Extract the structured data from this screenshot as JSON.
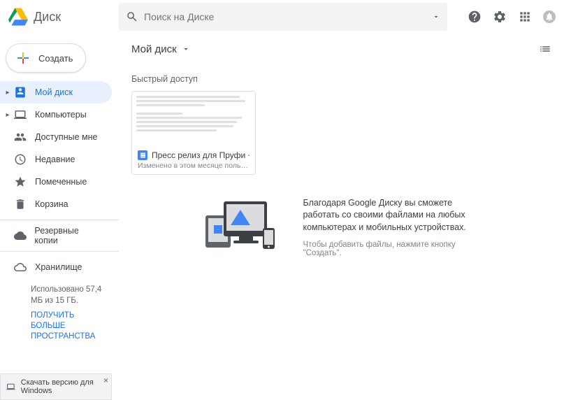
{
  "header": {
    "app_name": "Диск",
    "search_placeholder": "Поиск на Диске"
  },
  "sidebar": {
    "create_label": "Создать",
    "items": [
      {
        "label": "Мой диск",
        "icon": "drive-icon",
        "active": true,
        "expandable": true
      },
      {
        "label": "Компьютеры",
        "icon": "computer-icon",
        "active": false,
        "expandable": true
      },
      {
        "label": "Доступные мне",
        "icon": "shared-icon",
        "active": false,
        "expandable": false
      },
      {
        "label": "Недавние",
        "icon": "clock-icon",
        "active": false,
        "expandable": false
      },
      {
        "label": "Помеченные",
        "icon": "star-icon",
        "active": false,
        "expandable": false
      },
      {
        "label": "Корзина",
        "icon": "trash-icon",
        "active": false,
        "expandable": false
      }
    ],
    "backups_label": "Резервные копии",
    "storage_label": "Хранилище",
    "storage_used": "Использовано 57,4 МБ из 15 ГБ.",
    "storage_more": "ПОЛУЧИТЬ БОЛЬШЕ ПРОСТРАНСТВА",
    "download_windows": "Скачать версию для Windows"
  },
  "main": {
    "breadcrumb": "Мой диск",
    "quick_access_title": "Быстрый доступ",
    "quick_item": {
      "title": "Пресс релиз для Пруфи + легенда ...",
      "modified": "Изменено в этом месяце пользователем ..."
    },
    "empty": {
      "headline": "Благодаря Google Диску вы сможете работать со своими файлами на любых компьютерах и мобильных устройствах.",
      "sub": "Чтобы добавить файлы, нажмите кнопку \"Создать\"."
    }
  }
}
